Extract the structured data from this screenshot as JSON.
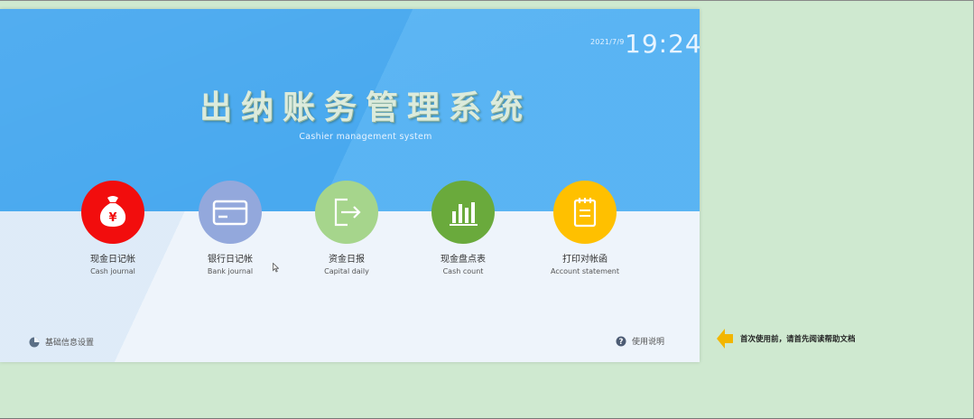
{
  "header": {
    "date": "2021/7/9",
    "time": "19:24",
    "title": "出纳账务管理系统",
    "subtitle": "Cashier management system"
  },
  "modules": [
    {
      "label": "现金日记帐",
      "en": "Cash journal",
      "color": "#f20d0d",
      "icon": "money-bag-icon"
    },
    {
      "label": "银行日记帐",
      "en": "Bank journal",
      "color": "#93a8dc",
      "icon": "bank-card-icon"
    },
    {
      "label": "资金日报",
      "en": "Capital daily",
      "color": "#a6d58c",
      "icon": "export-arrow-icon"
    },
    {
      "label": "现金盘点表",
      "en": "Cash count",
      "color": "#6aaa3c",
      "icon": "bar-chart-icon"
    },
    {
      "label": "打印对帐函",
      "en": "Account statement",
      "color": "#ffc000",
      "icon": "clipboard-icon"
    }
  ],
  "footer": {
    "settings_label": "基础信息设置",
    "help_label": "使用说明"
  },
  "tip": {
    "text": "首次使用前，请首先阅读帮助文档",
    "arrow_color": "#f2b600"
  }
}
